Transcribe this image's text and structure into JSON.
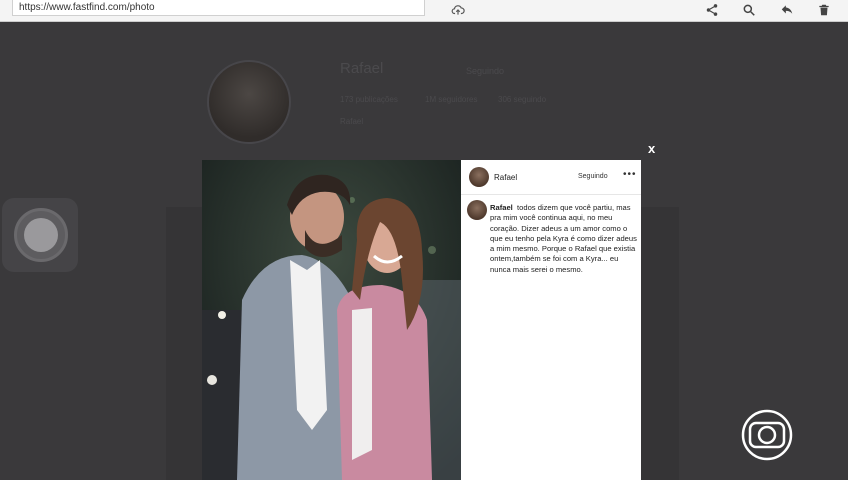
{
  "browser": {
    "url": "https://www.fastfind.com/photo",
    "icons": [
      "cloud-upload-icon",
      "share-icon",
      "search-icon",
      "back-icon",
      "trash-icon"
    ]
  },
  "profile": {
    "name": "Rafael",
    "follow_label": "Seguindo",
    "stats": [
      "173 publicações",
      "1M seguidores",
      "306 seguindo"
    ],
    "bio": "Rafael"
  },
  "modal": {
    "close_label": "x",
    "header": {
      "username": "Rafael",
      "follow_label": "Seguindo",
      "more_label": "•••"
    },
    "post": {
      "author": "Rafael",
      "text": "todos dizem que você partiu, mas pra mim você continua aqui, no meu coração. Dizer adeus a um amor como o que eu tenho pela Kyra é como dizer adeus a mim mesmo. Porque o Rafael que existia ontem,também se foi com a Kyra... eu nunca mais serei o mesmo."
    }
  },
  "colors": {
    "page_bg": "#3a393b",
    "panel_bg": "#ffffff",
    "topbar_bg": "#f4f4f4"
  }
}
